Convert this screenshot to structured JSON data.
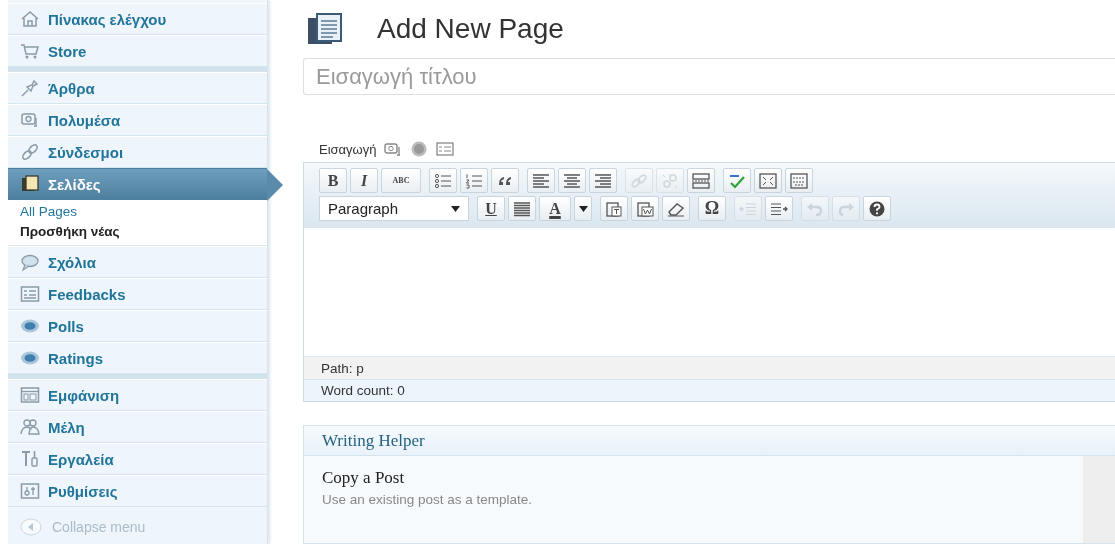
{
  "sidebar": {
    "groups": [
      {
        "items": [
          {
            "label": "Πίνακας ελέγχου",
            "selected": false
          },
          {
            "label": "Store",
            "selected": false
          }
        ]
      },
      {
        "items": [
          {
            "label": "Άρθρα",
            "selected": false
          },
          {
            "label": "Πολυμέσα",
            "selected": false
          },
          {
            "label": "Σύνδεσμοι",
            "selected": false
          },
          {
            "label": "Σελίδες",
            "selected": true,
            "children": [
              {
                "label": "All Pages",
                "selected": false
              },
              {
                "label": "Προσθήκη νέας",
                "selected": true
              }
            ]
          },
          {
            "label": "Σχόλια",
            "selected": false
          },
          {
            "label": "Feedbacks",
            "selected": false
          },
          {
            "label": "Polls",
            "selected": false
          },
          {
            "label": "Ratings",
            "selected": false
          }
        ]
      },
      {
        "items": [
          {
            "label": "Εμφάνιση",
            "selected": false
          },
          {
            "label": "Μέλη",
            "selected": false
          },
          {
            "label": "Εργαλεία",
            "selected": false
          },
          {
            "label": "Ρυθμίσεις",
            "selected": false
          }
        ]
      }
    ],
    "collapse": "Collapse menu"
  },
  "header": {
    "title": "Add New Page"
  },
  "title_field": {
    "placeholder": "Εισαγωγή τίτλου"
  },
  "media": {
    "label": "Εισαγωγή"
  },
  "toolbar": {
    "rows": [
      [
        [
          {
            "kind": "bold",
            "glyph": "B",
            "disabled": false
          },
          {
            "kind": "italic",
            "glyph": "I",
            "disabled": false
          },
          {
            "kind": "strike",
            "glyph": "ABC",
            "disabled": false
          }
        ],
        [
          {
            "kind": "bullets",
            "disabled": false
          },
          {
            "kind": "numbers",
            "disabled": false
          },
          {
            "kind": "quote",
            "disabled": false
          }
        ],
        [
          {
            "kind": "align-left",
            "disabled": false
          },
          {
            "kind": "align-center",
            "disabled": false
          },
          {
            "kind": "align-right",
            "disabled": false
          }
        ],
        [
          {
            "kind": "link",
            "disabled": true
          },
          {
            "kind": "unlink",
            "disabled": true
          },
          {
            "kind": "more",
            "disabled": false
          }
        ],
        [
          {
            "kind": "spellcheck",
            "disabled": false
          },
          {
            "kind": "fullscreen",
            "disabled": false
          },
          {
            "kind": "kitchen-sink",
            "disabled": false
          }
        ]
      ],
      [
        [
          {
            "kind": "select",
            "value": "Paragraph",
            "disabled": false
          }
        ],
        [
          {
            "kind": "underline",
            "glyph": "U",
            "disabled": false
          },
          {
            "kind": "justify",
            "disabled": false
          },
          {
            "kind": "color",
            "glyph": "A",
            "disabled": false
          }
        ],
        [
          {
            "kind": "paste-text",
            "disabled": false
          },
          {
            "kind": "paste-word",
            "disabled": false
          },
          {
            "kind": "eraser",
            "disabled": false
          }
        ],
        [
          {
            "kind": "charmap",
            "glyph": "Ω",
            "disabled": false
          }
        ],
        [
          {
            "kind": "outdent",
            "disabled": true
          },
          {
            "kind": "indent",
            "disabled": false
          }
        ],
        [
          {
            "kind": "undo",
            "disabled": true
          },
          {
            "kind": "redo",
            "disabled": true
          },
          {
            "kind": "help",
            "disabled": false
          }
        ]
      ]
    ]
  },
  "editor": {
    "path": "Path: p",
    "word_count": "Word count: 0"
  },
  "writing_helper": {
    "title": "Writing Helper",
    "item_title": "Copy a Post",
    "item_text": "Use an existing post as a template."
  }
}
